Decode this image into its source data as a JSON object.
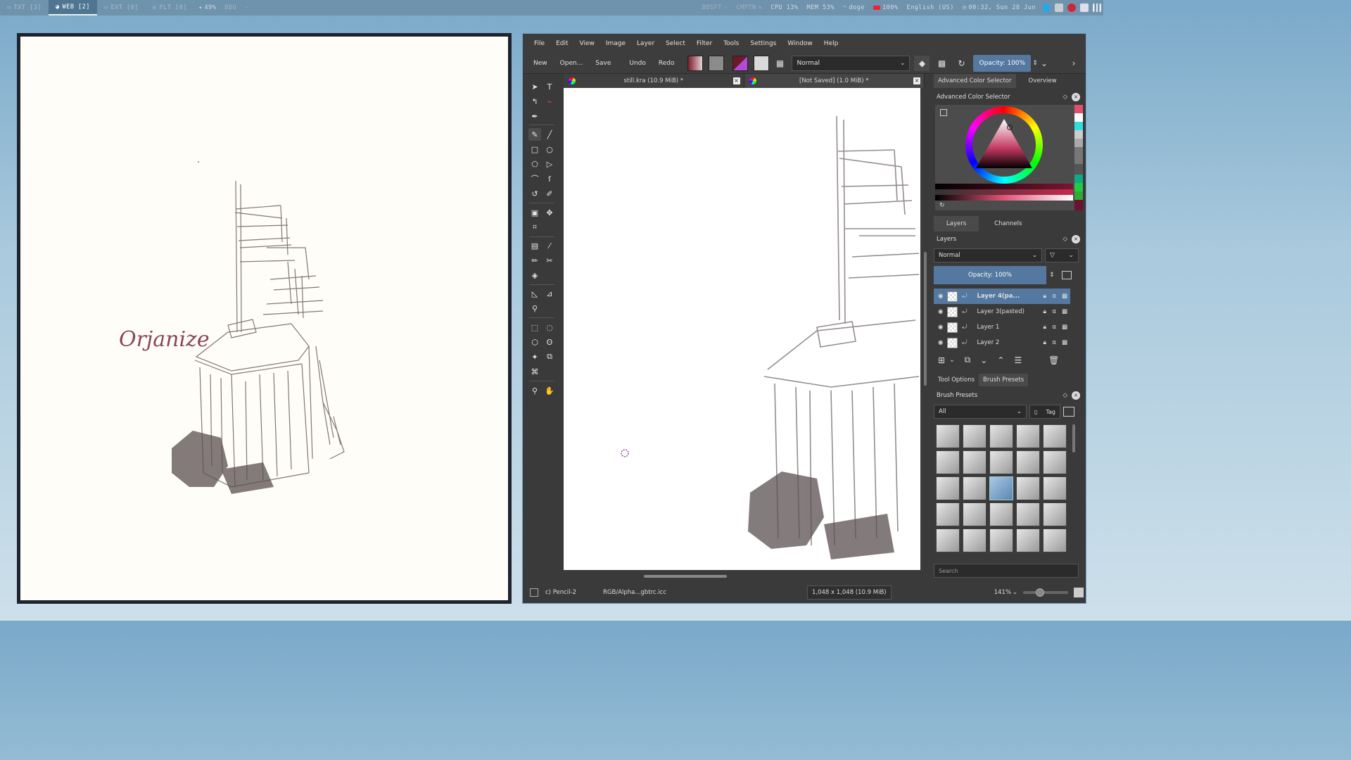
{
  "topbar": {
    "workspaces": [
      {
        "icon": "terminal-icon",
        "label": "TXT [3]"
      },
      {
        "icon": "globe-icon",
        "label": "WEB [2]"
      },
      {
        "icon": "monitor-icon",
        "label": "EXT [0]"
      },
      {
        "icon": "float-icon",
        "label": "FLT [0]"
      }
    ],
    "volume": "49%",
    "bbq": "BBQ",
    "dash": "-",
    "bdsft": "BDSFT",
    "cmptn": "CMPTN",
    "cpu": "CPU 13%",
    "mem": "MEM 53%",
    "wifi": "doge",
    "battery": "100%",
    "layout": "English (US)",
    "clock": "00:32, Sun 28 Jun"
  },
  "left_canvas": {
    "annotation": "Orjanize"
  },
  "krita": {
    "menu": [
      "File",
      "Edit",
      "View",
      "Image",
      "Layer",
      "Select",
      "Filter",
      "Tools",
      "Settings",
      "Window",
      "Help"
    ],
    "toolbar": {
      "new": "New",
      "open": "Open...",
      "save": "Save",
      "undo": "Undo",
      "redo": "Redo",
      "blend_mode": "Normal",
      "opacity": "Opacity: 100%"
    },
    "tabs": [
      {
        "title": "still.kra (10.9 MiB) *",
        "close": "×"
      },
      {
        "title": "[Not Saved]  (1.0 MiB) *",
        "close": "×"
      }
    ],
    "status": {
      "brush": "c) Pencil-2",
      "colorspace": "RGB/Alpha...gbtrc.icc",
      "size": "1,048 x 1,048 (10.9 MiB)",
      "zoom": "141%"
    },
    "dockers": {
      "top_tabs": [
        "Advanced Color Selector",
        "Overview"
      ],
      "color_selector_title": "Advanced Color Selector",
      "layers_tabs": [
        "Layers",
        "Channels"
      ],
      "layers_title": "Layers",
      "layers_blend": "Normal",
      "layers_opacity": "Opacity:  100%",
      "layers": [
        {
          "name": "Layer 4(pa...",
          "selected": true
        },
        {
          "name": "Layer 3(pasted)",
          "selected": false
        },
        {
          "name": "Layer 1",
          "selected": false
        },
        {
          "name": "Layer 2",
          "selected": false
        }
      ],
      "bottom_tabs": [
        "Tool Options",
        "Brush Presets"
      ],
      "brush_title": "Brush Presets",
      "brush_filter": "All",
      "brush_tag": "Tag",
      "brush_search_placeholder": "Search"
    }
  }
}
